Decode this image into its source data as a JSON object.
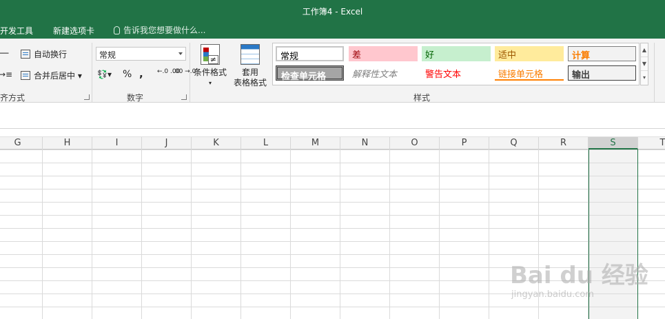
{
  "window": {
    "title": "工作簿4 - Excel"
  },
  "ribbon_tabs": [
    "开发工具",
    "新建选项卡"
  ],
  "tell_me": {
    "text": "告诉我您想要做什么..."
  },
  "alignment": {
    "wrap_text": "自动换行",
    "merge_center": "合并后居中",
    "group_label": "齐方式"
  },
  "number": {
    "format_value": "常规",
    "percent": "%",
    "comma": ",",
    "increase_decimal": "←.0 .00",
    "decrease_decimal": ".00 →.0",
    "group_label": "数字"
  },
  "styles": {
    "conditional_format": "条件格式",
    "format_as_table_line1": "套用",
    "format_as_table_line2": "表格格式",
    "cells": [
      {
        "label": "常规"
      },
      {
        "label": "差"
      },
      {
        "label": "好"
      },
      {
        "label": "适中"
      },
      {
        "label": "计算"
      },
      {
        "label": "检查单元格"
      },
      {
        "label": "解释性文本"
      },
      {
        "label": "警告文本"
      },
      {
        "label": "链接单元格"
      },
      {
        "label": "输出"
      }
    ],
    "group_label": "样式"
  },
  "columns": [
    "G",
    "H",
    "I",
    "J",
    "K",
    "L",
    "M",
    "N",
    "O",
    "P",
    "Q",
    "R",
    "S",
    "T"
  ],
  "selected_column": "S",
  "watermark": {
    "brand": "Bai du 经验",
    "url": "jingyan.baidu.com"
  }
}
